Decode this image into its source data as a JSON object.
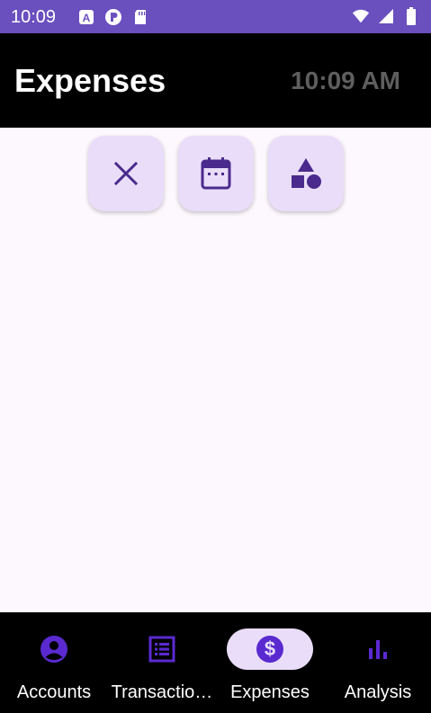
{
  "status_bar": {
    "time": "10:09",
    "left_icons": [
      "a-badge-icon",
      "p-badge-icon",
      "sd-card-icon"
    ],
    "right_icons": [
      "wifi-icon",
      "cell-signal-icon",
      "battery-icon"
    ]
  },
  "app_bar": {
    "title": "Expenses",
    "clock": "10:09 AM"
  },
  "filter_chips": [
    {
      "icon": "close-icon"
    },
    {
      "icon": "calendar-icon"
    },
    {
      "icon": "category-shapes-icon"
    }
  ],
  "bottom_nav": {
    "items": [
      {
        "label": "Accounts",
        "icon": "account-circle-icon",
        "active": false
      },
      {
        "label": "Transactio…",
        "icon": "list-icon",
        "active": false
      },
      {
        "label": "Expenses",
        "icon": "dollar-circle-icon",
        "active": true
      },
      {
        "label": "Analysis",
        "icon": "bar-chart-icon",
        "active": false
      }
    ]
  },
  "colors": {
    "status_bar": "#6a4fbf",
    "app_bar": "#000000",
    "chip_bg": "#e9ddf9",
    "accent": "#4a2a8c",
    "nav_icon": "#5a2ad0",
    "clock_text": "#5e5e5e"
  }
}
